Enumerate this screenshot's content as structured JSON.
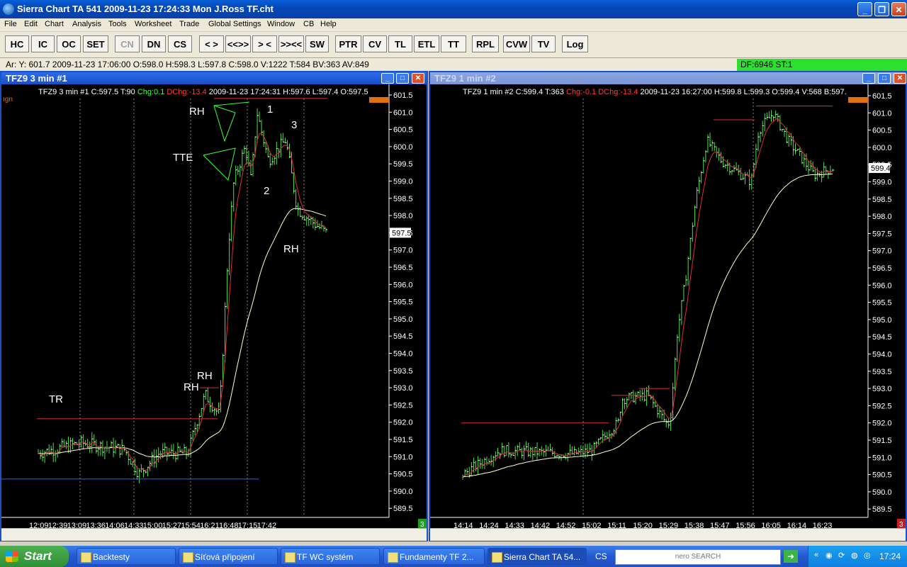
{
  "window": {
    "title": "Sierra Chart TA 541  2009-11-23  17:24:33  Mon   J.Ross TF.cht"
  },
  "menu": [
    "File",
    "Edit",
    "Chart",
    "Analysis",
    "Tools",
    "Worksheet",
    "Trade",
    "Global Settings",
    "Window",
    "CB",
    "Help"
  ],
  "toolbar": [
    {
      "label": "HC",
      "enabled": true
    },
    {
      "label": "IC",
      "enabled": true
    },
    {
      "label": "OC",
      "enabled": true
    },
    {
      "label": "SET",
      "enabled": true
    },
    {
      "label": "CN",
      "enabled": false
    },
    {
      "label": "DN",
      "enabled": true
    },
    {
      "label": "CS",
      "enabled": true
    },
    {
      "label": "< >",
      "enabled": true
    },
    {
      "label": "<<>>",
      "enabled": true
    },
    {
      "label": "> <",
      "enabled": true
    },
    {
      "label": ">><<",
      "enabled": true
    },
    {
      "label": "SW",
      "enabled": true
    },
    {
      "label": "PTR",
      "enabled": true
    },
    {
      "label": "CV",
      "enabled": true
    },
    {
      "label": "TL",
      "enabled": true
    },
    {
      "label": "ETL",
      "enabled": true
    },
    {
      "label": "TT",
      "enabled": true
    },
    {
      "label": "RPL",
      "enabled": true
    },
    {
      "label": "CVW",
      "enabled": true
    },
    {
      "label": "TV",
      "enabled": true
    },
    {
      "label": "Log",
      "enabled": true
    }
  ],
  "status": {
    "cursor": "Ar: Y: 601.7  2009-11-23  17:06:00  O:598.0  H:598.3  L:597.8  C:598.0  V:1222  T:584  BV:363  AV:849",
    "df": "DF:6946   ST:1"
  },
  "chart1": {
    "window_title": "TFZ9   3 min   #1",
    "info_base": "TFZ9  3 min   #1  C:597.5  T:90 ",
    "info_chg": "Chg:0.1",
    "info_dchg": "DChg:-13.4",
    "info_rest": " 2009-11-23   17:24:31  H:597.6  L:597.4  O:597.5",
    "price_labels": [
      "601.5",
      "601.0",
      "600.5",
      "600.0",
      "599.5",
      "599.0",
      "598.5",
      "598.0",
      "597.5",
      "597.0",
      "596.5",
      "596.0",
      "595.5",
      "595.0",
      "594.5",
      "594.0",
      "593.5",
      "593.0",
      "592.5",
      "592.0",
      "591.5",
      "591.0",
      "590.5",
      "590.0",
      "589.5"
    ],
    "current_price": "597.5",
    "time_labels": [
      "12:09",
      "12:39",
      "13:09",
      "13:36",
      "14:06",
      "14:33",
      "15:00",
      "15:27",
      "15:54",
      "16:21",
      "16:48",
      "17:15",
      "17:42"
    ],
    "annotations": [
      "RH",
      "1",
      "3",
      "TTE",
      "2",
      "RH",
      "TR",
      "RH",
      "RH"
    ],
    "corner_tag": "3",
    "top_left_tag": "ıgn"
  },
  "chart2": {
    "window_title": "TFZ9   1 min   #2",
    "info_base": "TFZ9  1 min   #2  C:599.4  T:363 ",
    "info_chg": "Chg:-0.1",
    "info_dchg": "DChg:-13.4",
    "info_rest": " 2009-11-23   16:27:00  H:599.8   L:599.3   O:599.4   V:568   B:597.",
    "price_labels": [
      "601.5",
      "601.0",
      "600.5",
      "600.0",
      "599.5",
      "599.0",
      "598.5",
      "598.0",
      "597.5",
      "597.0",
      "596.5",
      "596.0",
      "595.5",
      "595.0",
      "594.5",
      "594.0",
      "593.5",
      "593.0",
      "592.5",
      "592.0",
      "591.5",
      "591.0",
      "590.5",
      "590.0",
      "589.5"
    ],
    "current_price": "599.4",
    "time_labels": [
      "14:14",
      "14:24",
      "14:33",
      "14:42",
      "14:52",
      "15:02",
      "15:11",
      "15:20",
      "15:29",
      "15:38",
      "15:47",
      "15:56",
      "16:05",
      "16:14",
      "16:23"
    ],
    "corner_tag": "3"
  },
  "taskbar": {
    "start": "Start",
    "tasks": [
      "Backtesty",
      "Síťová připojení",
      "TF WC systém",
      "Fundamenty TF 2...",
      "Sierra Chart TA 54..."
    ],
    "lang": "CS",
    "search_brand": "nero SEARCH",
    "clock": "17:24"
  }
}
